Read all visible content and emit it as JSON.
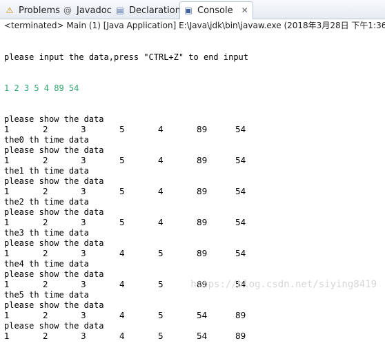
{
  "tabs": [
    {
      "label": "Problems",
      "icon": "problems-icon",
      "glyph": "⚠"
    },
    {
      "label": "Javadoc",
      "icon": "at-icon",
      "glyph": "@"
    },
    {
      "label": "Declaration",
      "icon": "declaration-icon",
      "glyph": "▤"
    },
    {
      "label": "Console",
      "icon": "console-icon",
      "glyph": "▣",
      "active": true
    }
  ],
  "close_glyph": "✕",
  "status": "<terminated> Main (1) [Java Application] E:\\Java\\jdk\\bin\\javaw.exe (2018年3月28日 下午1:36:31)",
  "console": {
    "prompt": "please input the data,press \"CTRL+Z\" to end input",
    "input_line": "1 2 3 5 4 89 54",
    "input_color": "#2ea56f",
    "blocks": [
      {
        "label": "please show the data",
        "values": [
          "1",
          "2",
          "3",
          "5",
          "4",
          "89",
          "54"
        ]
      },
      {
        "label": "the0 th time data",
        "sub": "please show the data",
        "values": [
          "1",
          "2",
          "3",
          "5",
          "4",
          "89",
          "54"
        ]
      },
      {
        "label": "the1 th time data",
        "sub": "please show the data",
        "values": [
          "1",
          "2",
          "3",
          "5",
          "4",
          "89",
          "54"
        ]
      },
      {
        "label": "the2 th time data",
        "sub": "please show the data",
        "values": [
          "1",
          "2",
          "3",
          "5",
          "4",
          "89",
          "54"
        ]
      },
      {
        "label": "the3 th time data",
        "sub": "please show the data",
        "values": [
          "1",
          "2",
          "3",
          "4",
          "5",
          "89",
          "54"
        ]
      },
      {
        "label": "the4 th time data",
        "sub": "please show the data",
        "values": [
          "1",
          "2",
          "3",
          "4",
          "5",
          "89",
          "54"
        ]
      },
      {
        "label": "the5 th time data",
        "sub": "please show the data",
        "values": [
          "1",
          "2",
          "3",
          "4",
          "5",
          "54",
          "89"
        ]
      },
      {
        "label": "please show the data",
        "values": [
          "1",
          "2",
          "3",
          "4",
          "5",
          "54",
          "89"
        ]
      }
    ]
  },
  "watermark": "https://blog.csdn.net/siying8419"
}
